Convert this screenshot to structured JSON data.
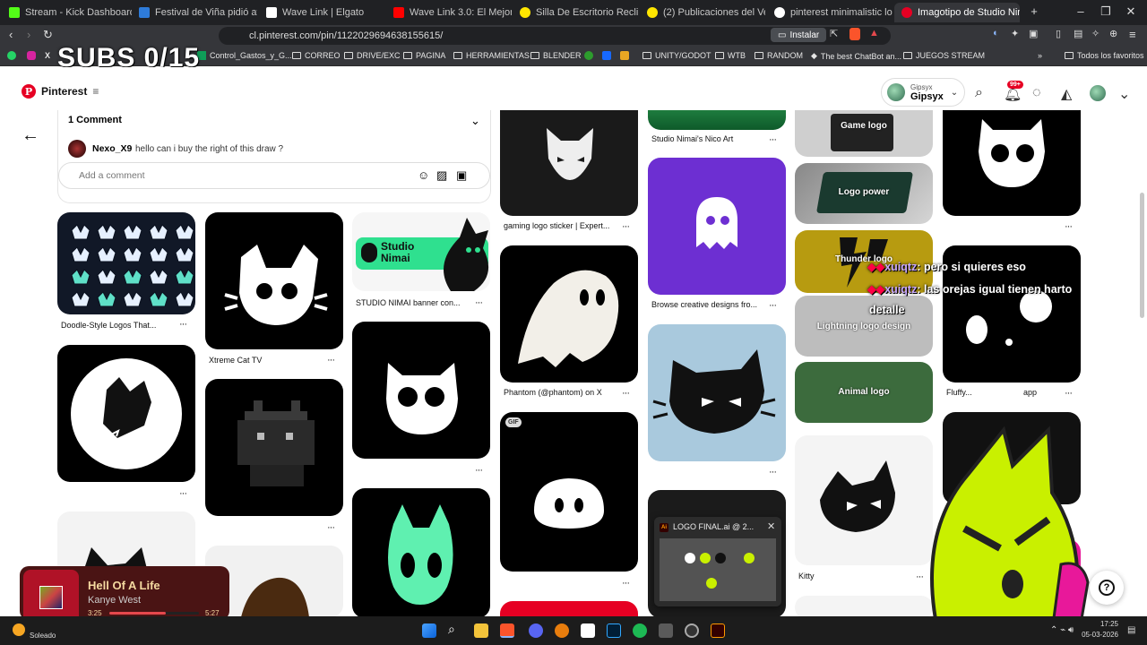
{
  "browser": {
    "tabs": [
      {
        "title": "Stream - Kick Dashboard",
        "color": "#53fc18"
      },
      {
        "title": "Festival de Viña pidió afiches s",
        "color": "#2e7bd9"
      },
      {
        "title": "Wave Link | Elgato",
        "color": "#ffffff"
      },
      {
        "title": "Wave Link 3.0: El Mejor Softwa",
        "color": "#ff0000"
      },
      {
        "title": "Silla De Escritorio Reclinable Pr",
        "color": "#ffe600"
      },
      {
        "title": "(2) Publicaciones del Vendedor",
        "color": "#ffe600"
      },
      {
        "title": "pinterest minimalistic logo - G",
        "color": "#ffffff"
      },
      {
        "title": "Imagotipo de Studio Nima",
        "color": "#e60023"
      }
    ],
    "url": "cl.pinterest.com/pin/1122029694638155615/",
    "install_label": "Instalar",
    "bookmarks": [
      "Control_Gastos_y_G...",
      "CORREO",
      "DRIVE/EXC",
      "PAGINA",
      "HERRAMIENTAS",
      "BLENDER",
      "UNITY/GODOT",
      "WTB",
      "RANDOM",
      "The best ChatBot an...",
      "JUEGOS STREAM"
    ],
    "all_favorites": "Todos los favoritos"
  },
  "overlay": {
    "subs": "SUBS 0/15",
    "chat": [
      {
        "user": "xuiqtz",
        "text": "pero si quieres eso"
      },
      {
        "user": "xuiqtz",
        "text": "las orejas igual tienen harto"
      },
      {
        "user": "",
        "text": "detalle"
      }
    ],
    "song": {
      "title": "Hell Of A Life",
      "artist": "Kanye West",
      "elapsed": "3:25",
      "total": "5:27",
      "progress": 0.63
    },
    "weather": "Soleado",
    "clock": {
      "time": "17:25",
      "date": "05-03-2026"
    },
    "ai_window": "LOGO FINAL.ai @ 2..."
  },
  "pinterest": {
    "brand": "Pinterest",
    "user": {
      "handle": "Gipsyx",
      "name": "Gipsyx"
    },
    "notifications": "99+",
    "comments": {
      "count_label": "1 Comment",
      "author": "Nexo_X9",
      "text": "hello can i buy the right of this draw ?",
      "placeholder": "Add a comment"
    },
    "pins": [
      {
        "caption": "Doodle-Style Logos That..."
      },
      {
        "caption": "Xtreme Cat TV"
      },
      {
        "caption": "STUDIO NIMAI banner con..."
      },
      {
        "caption": "gaming logo sticker | Expert..."
      },
      {
        "caption": "Phantom (@phantom) on X"
      },
      {
        "caption": "Studio Nimai's Nico Art"
      },
      {
        "caption": "Browse creative designs fro..."
      },
      {
        "caption": "Kitty"
      },
      {
        "caption": "Fluffy..."
      },
      {
        "caption": "app"
      }
    ],
    "tile_labels": [
      "Game logo",
      "Logo power",
      "Thunder logo",
      "Lightning logo design",
      "Animal logo"
    ],
    "banner_text": "Studio Nimai",
    "gif_badge": "GIF",
    "help": "?"
  }
}
